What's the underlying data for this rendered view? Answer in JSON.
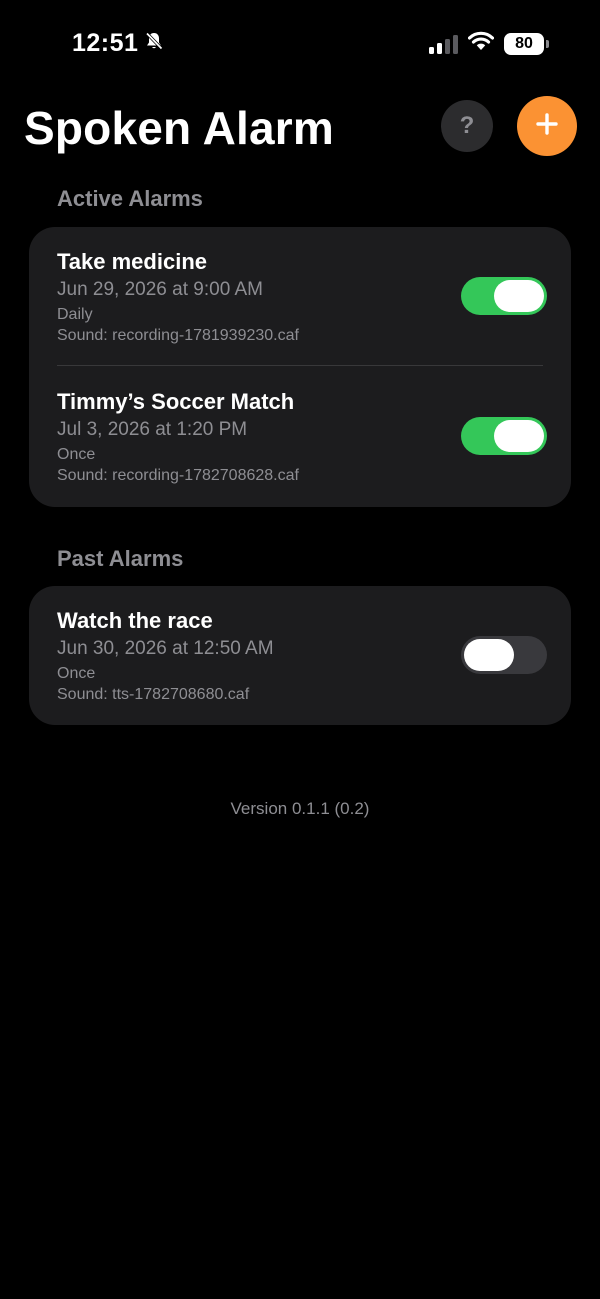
{
  "status_bar": {
    "time": "12:51",
    "battery": "80"
  },
  "header": {
    "title": "Spoken Alarm",
    "help_label": "?"
  },
  "sections": {
    "active_title": "Active Alarms",
    "past_title": "Past Alarms"
  },
  "active_alarms": [
    {
      "title": "Take medicine",
      "datetime": "Jun 29, 2026 at 9:00 AM",
      "repeat": "Daily",
      "sound": "Sound: recording-1781939230.caf",
      "enabled": true
    },
    {
      "title": "Timmy’s Soccer Match",
      "datetime": "Jul 3, 2026 at 1:20 PM",
      "repeat": "Once",
      "sound": "Sound: recording-1782708628.caf",
      "enabled": true
    }
  ],
  "past_alarms": [
    {
      "title": "Watch the race",
      "datetime": "Jun 30, 2026 at 12:50 AM",
      "repeat": "Once",
      "sound": "Sound: tts-1782708680.caf",
      "enabled": false
    }
  ],
  "footer": {
    "version": "Version 0.1.1 (0.2)"
  },
  "colors": {
    "accent": "#fb9233",
    "toggle_on": "#34c759",
    "background": "#000000",
    "card": "#1c1c1e",
    "secondary_text": "#8e8e93"
  },
  "icons": {
    "silent_mode": "bell-slash-icon",
    "signal": "cellular-signal-icon",
    "wifi": "wifi-icon",
    "battery": "battery-icon",
    "add": "plus-icon"
  }
}
